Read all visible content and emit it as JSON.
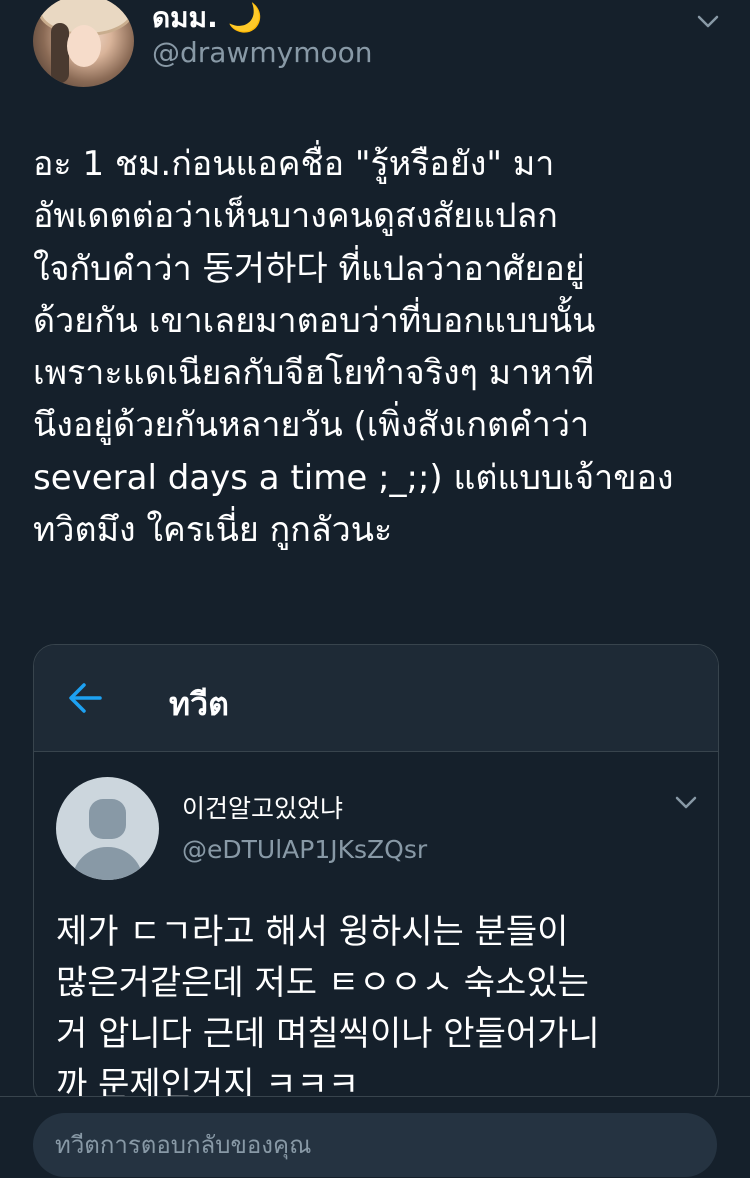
{
  "tweet": {
    "author": {
      "display_name": "ดมม. 🌙",
      "username": "@drawmymoon"
    },
    "text": "อะ 1 ชม.ก่อนแอคชื่อ \"รู้หรือยัง\" มา\nอัพเดตต่อว่าเห็นบางคนดูสงสัยแปลก\n ใจกับคำว่า 동거하다 ที่แปลว่าอาศัยอยู่\nด้วยกัน เขาเลยมาตอบว่าที่บอกแบบนั้น\nเพราะแดเนียลกับจีฮโยทำจริงๆ มาหาที\nนึงอยู่ด้วยกันหลายวัน (เพิ่งสังเกตคำว่า\nseveral days a time ;_;;) แต่แบบเจ้าของ\nทวิตมึง ใครเนี่ย กูกลัวนะ"
  },
  "quoted": {
    "title": "ทวีต",
    "author": {
      "display_name": "이건알고있었냐",
      "username": "@eDTUlAP1JKsZQsr"
    },
    "text": "제가 ㄷㄱ라고 해서 윙하시는 분들이\n많은거같은데 저도 ㅌㅇㅇㅅ 숙소있는\n거 압니다 근데 며칠씩이나 안들어가니\n까 문제인거지 ㅋㅋㅋ"
  },
  "reply": {
    "placeholder": "ทวีตการตอบกลับของคุณ"
  },
  "icons": {
    "back": "back-arrow-icon",
    "more": "chevron-down-icon",
    "default_avatar": "default-avatar-icon"
  },
  "colors": {
    "background": "#15202b",
    "card_header": "#1e2a36",
    "border": "#38444d",
    "accent": "#1da1f2",
    "muted_text": "#8899a6",
    "input_bg": "#253341"
  }
}
